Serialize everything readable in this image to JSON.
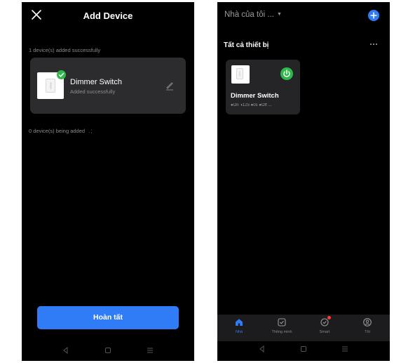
{
  "add_device": {
    "title": "Add Device",
    "added_label": "1 device(s) added successfully",
    "device": {
      "name": "Dimmer Switch",
      "status": "Added successfully"
    },
    "adding_label": "0 device(s) being added",
    "adding_indicator": ".;",
    "done_label": "Hoàn tất",
    "icons": {
      "close": "close-icon",
      "edit": "edit-icon",
      "success": "check-icon"
    },
    "colors": {
      "accent": "#2f7cf6",
      "success": "#2fb84a",
      "card": "#2c2c2e"
    }
  },
  "home": {
    "home_name": "Nhà của tôi ...",
    "section_title": "Tất cả thiết bị",
    "device_tile": {
      "name": "Dimmer Switch",
      "stats": "●On ◑125 ●0s ●Off ..."
    },
    "tabs": [
      {
        "label": "Nhà",
        "icon": "home-icon",
        "active": true
      },
      {
        "label": "Thông minh",
        "icon": "checkbox-icon",
        "active": false
      },
      {
        "label": "Smart",
        "icon": "smart-shield-icon",
        "active": false
      },
      {
        "label": "Tôi",
        "icon": "profile-icon",
        "active": false
      }
    ],
    "colors": {
      "accent": "#2f7cf6",
      "power_on": "#2fb84a",
      "notification": "#ff3b30"
    }
  },
  "system_nav": {
    "buttons": [
      "back-icon",
      "home-square-icon",
      "menu-icon"
    ]
  }
}
